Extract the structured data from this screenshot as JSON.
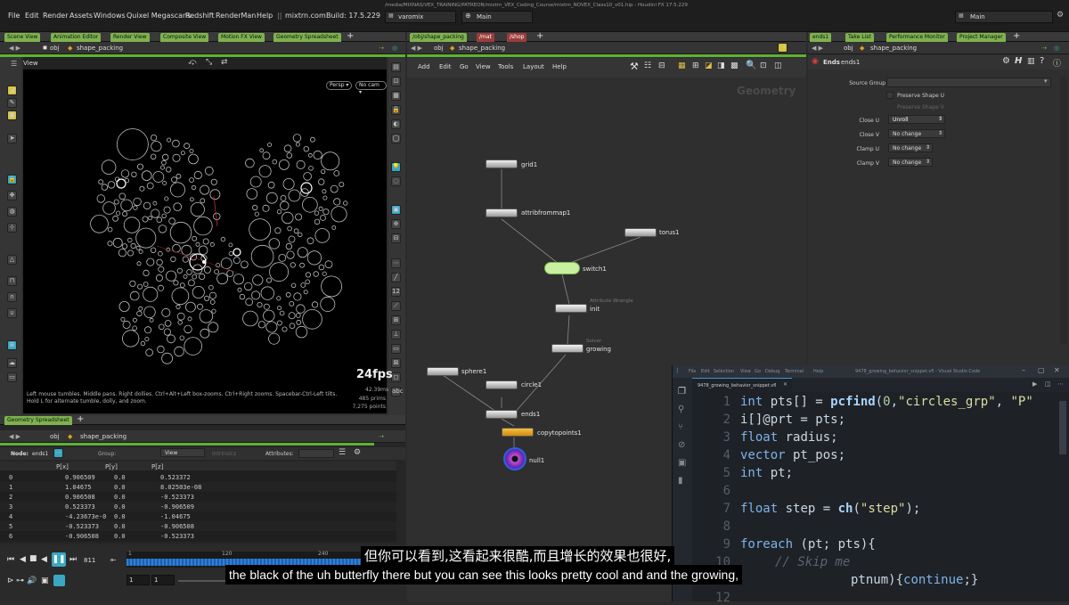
{
  "menubar": {
    "items": [
      "File",
      "Edit",
      "Render",
      "Assets",
      "Windows",
      "Quixel Megascans",
      "Redshift",
      "RenderMan",
      "Help"
    ],
    "separator": "||",
    "site": "mixtrn.com",
    "build": "Build: 17.5.229",
    "filepath": "/media/MIXNAS/VEX_TRAINING/PATREON/mixtrn_VEX_Coding_Course/mixtrn_NOVEX_Class10_v01.hip - Houdini FX 17.5.229",
    "desktop": "varomix",
    "takes": "Main",
    "right_takes": "Main"
  },
  "left_pane": {
    "tabs": [
      "Scene View",
      "Animation Editor",
      "Render View",
      "Composite View",
      "Motion FX View",
      "Geometry Spreadsheet"
    ],
    "path_obj": "obj",
    "path_node": "shape_packing",
    "view_label": "View",
    "cam_persp": "Persp",
    "cam_nocam": "No cam",
    "fps": "24fps",
    "stats": [
      "42.39ms",
      "485 prims",
      "7,275 points"
    ],
    "help_text": "Left mouse tumbles. Middle pans. Right dollies. Ctrl+Alt+Left box-zooms. Ctrl+Right zooms. Spacebar-Ctrl-Left tilts. Hold L for alternate tumble, dolly, and zoom."
  },
  "spreadsheet": {
    "tab": "Geometry Spreadsheet",
    "path_obj": "obj",
    "path_node": "shape_packing",
    "node_label": "Node:",
    "node_value": "ends1",
    "group_label": "Group:",
    "view_label": "View",
    "intrinsics_label": "Intrinsics",
    "attributes_label": "Attributes:",
    "columns": [
      "",
      "P[x]",
      "P[y]",
      "P[z]"
    ],
    "rows": [
      [
        "0",
        "0.906509",
        "0.0",
        "0.523372"
      ],
      [
        "1",
        "1.04675",
        "0.0",
        "8.02503e-08"
      ],
      [
        "2",
        "0.906508",
        "0.0",
        "-0.523373"
      ],
      [
        "3",
        "0.523373",
        "0.0",
        "-0.906509"
      ],
      [
        "4",
        "-4.23673e-0",
        "0.0",
        "-1.04675"
      ],
      [
        "5",
        "-0.523373",
        "0.0",
        "-0.906508"
      ],
      [
        "6",
        "-0.906508",
        "0.0",
        "-0.523373"
      ]
    ]
  },
  "timeline": {
    "frame": "811",
    "tick_120": "120",
    "tick_240": "240",
    "start1": "1",
    "start2": "1"
  },
  "network": {
    "tabs": [
      "/obj/shape_packing",
      "/mat",
      "/shop"
    ],
    "path_obj": "obj",
    "path_node": "shape_packing",
    "menu": [
      "Add",
      "Edit",
      "Go",
      "View",
      "Tools",
      "Layout",
      "Help"
    ],
    "context_label": "Geometry",
    "nodes": {
      "grid1": "grid1",
      "attribfrommap1": "attribfrommap1",
      "torus1": "torus1",
      "switch1": "switch1",
      "init_sub": "Attribute Wrangle",
      "init": "init",
      "growing_sub": "Solver",
      "growing": "growing",
      "sphere1": "sphere1",
      "circle1": "circle1",
      "ends1": "ends1",
      "copytopoints1": "copytopoints1",
      "null1": "null1"
    }
  },
  "params": {
    "tabs": [
      "ends1",
      "Take List",
      "Performance Monitor",
      "Project Manager"
    ],
    "path_obj": "obj",
    "path_node": "shape_packing",
    "node_type": "Ends",
    "node_name": "ends1",
    "source_group_label": "Source Group",
    "preserve_u": "Preserve Shape U",
    "preserve_v": "Preserve Shape V",
    "close_u_label": "Close U",
    "close_u_value": "Unroll",
    "close_v_label": "Close V",
    "close_v_value": "No change",
    "clamp_u_label": "Clamp U",
    "clamp_u_value": "No change",
    "clamp_v_label": "Clamp V",
    "clamp_v_value": "No change"
  },
  "vscode": {
    "menu": [
      "File",
      "Edit",
      "Selection",
      "View",
      "Go",
      "Debug",
      "Terminal",
      "Help"
    ],
    "title": "9478_growing_behavior_snippet.vfl - Visual Studio Code",
    "tab": "9478_growing_behavior_snippet.vfl",
    "line_numbers": [
      "1",
      "2",
      "3",
      "4",
      "5",
      "6",
      "7",
      "8",
      "9",
      "10",
      "11",
      "12"
    ]
  },
  "subtitles": {
    "chinese": "但你可以看到,这看起来很酷,而且增长的效果也很好,",
    "english": "the black of the uh butterfly there but you can see this looks pretty cool and and the growing,"
  },
  "colors": {
    "houdini_green": "#5fb233",
    "accent_cyan": "#3aa8c1",
    "node_yellow": "#e0a020",
    "null_purple": "#8a3fc0"
  }
}
